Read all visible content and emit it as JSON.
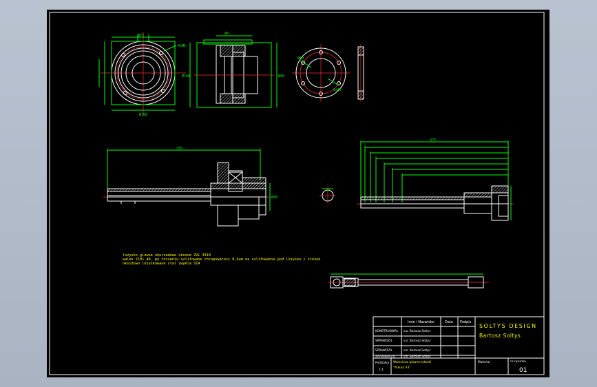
{
  "notes": [
    "lozysko glowne okurzadowe skosne ZVL 3310",
    "walek 2101 40, po toczeniu szlifowane chropowatosc 0,4um na szlifowanie pod lozysko i stozek",
    "oksidowo lozyskowane stal zwykla S14"
  ],
  "title_block": {
    "col_name_header": "Imie i Nazwisko",
    "col_date_header": "Data",
    "col_sign_header": "Podpis",
    "rows": [
      {
        "role": "KONSTRUOWAL",
        "name": "inz. Bartosz Soltys"
      },
      {
        "role": "SPRAWDZIL",
        "name": "inz. Bartosz Soltys"
      },
      {
        "role": "SPRAWDZIL",
        "name": "inz. Bartosz Soltys"
      },
      {
        "role": "ZATWIERDZIL",
        "name": "inz. Bartosz Soltys"
      }
    ],
    "company": "SOLTYS DESIGN",
    "author": "Bartosz Soltys",
    "scale_label": "Podzialka",
    "scale_value": "1:1",
    "drawing_name": "Wrzeciono glowne tokarki",
    "drawing_sub": "\"Arkusz A3\"",
    "material_label": "Material",
    "sheet_label": "nr rysunku",
    "sheet_number": "01"
  }
}
